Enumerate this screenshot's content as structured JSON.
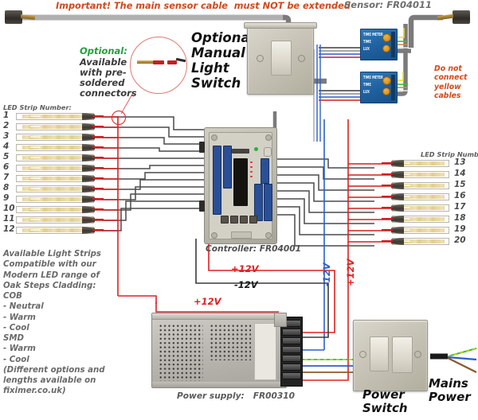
{
  "diagram": {
    "title_warning": "Important! The main sensor cable  must NOT be extended",
    "sensor_label": "Sensor: FR04011",
    "optional_callout": {
      "heading": "Optional:",
      "body": "Available\nwith pre-\nsoldered\nconnectors"
    },
    "manual_switch_title": "Optional\nManual\nLight\nSwitch",
    "do_not_connect_warning": "Do not\nconnect\nyellow\ncables",
    "left_strip_header": "LED Strip Number:",
    "right_strip_header": "LED Strip Number:",
    "left_strip_numbers": [
      "1",
      "2",
      "3",
      "4",
      "5",
      "6",
      "7",
      "8",
      "9",
      "10",
      "11",
      "12"
    ],
    "right_strip_numbers": [
      "13",
      "14",
      "15",
      "16",
      "17",
      "18",
      "19",
      "20"
    ],
    "controller_label": "Controller: FR04001",
    "power_supply_label": "Power supply:   FR00310",
    "power_switch_label": "Power\nSwitch",
    "mains_power_label": "Mains\nPower",
    "voltage_labels": {
      "plus12_top": "+12V",
      "minus12_top": "-12V",
      "plus12_psu": "+12V",
      "minus12_vertical": "-12V",
      "plus12_vertical": "+12V"
    },
    "info_text": "Available Light Strips\nCompatible with our\nModern LED range of\nOak Steps Cladding:\nCOB\n- Neutral\n- Warm\n- Cool\nSMD\n- Warm\n- Cool\n(Different options and\nlengths available on\nfiximer.co.uk)",
    "colors": {
      "warning_red": "#d2491b",
      "optional_green": "#23a13a",
      "wire_red": "#e02020",
      "wire_blue": "#2a5fd0",
      "wire_black": "#3a3a3a",
      "earth_green": "#3fbf2f",
      "earth_yellow": "#e8e020",
      "brown_live": "#8a5a2b",
      "pcb_blue": "#2a4f96"
    },
    "pir_modules": [
      {
        "lines": "TIME METER\nTIME\nLUX"
      },
      {
        "lines": "TIME METER\nTIME\nLUX"
      }
    ]
  }
}
